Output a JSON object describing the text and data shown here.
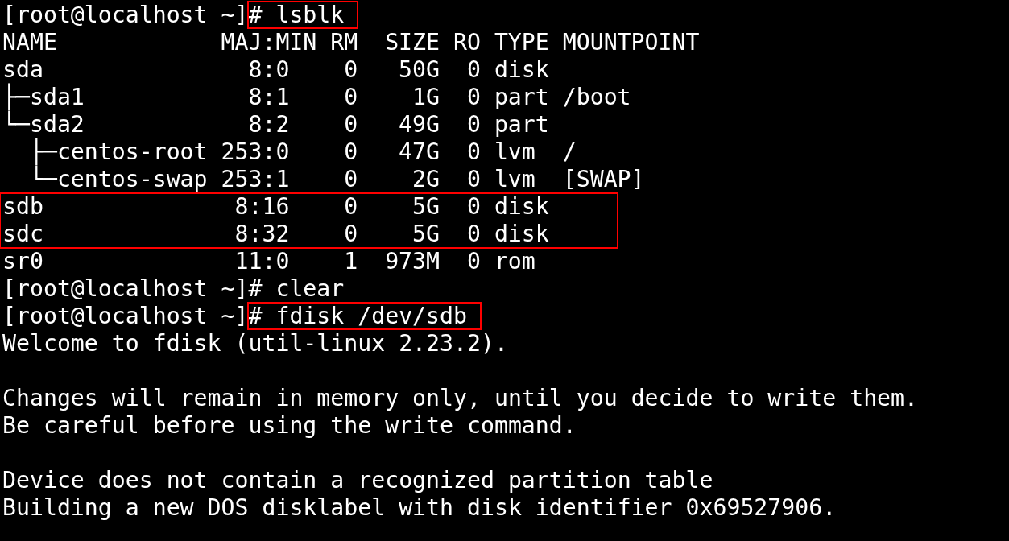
{
  "terminal": [
    {
      "kind": "prompt",
      "prompt": "[root@localhost ~]",
      "command": "# lsblk",
      "highlighted": true
    },
    {
      "kind": "table",
      "columns": [
        "NAME",
        "MAJ:MIN",
        "RM",
        "SIZE",
        "RO",
        "TYPE",
        "MOUNTPOINT"
      ],
      "rows": [
        {
          "name": "sda",
          "maj_min": "8:0",
          "rm": "0",
          "size": "50G",
          "ro": "0",
          "type": "disk",
          "highlighted": false
        },
        {
          "name": "├─sda1",
          "maj_min": "8:1",
          "rm": "0",
          "size": "1G",
          "ro": "0",
          "type": "part",
          "mountpoint": "/boot",
          "highlighted": false
        },
        {
          "name": "└─sda2",
          "maj_min": "8:2",
          "rm": "0",
          "size": "49G",
          "ro": "0",
          "type": "part",
          "highlighted": false
        },
        {
          "name": "  ├─centos-root",
          "maj_min": "253:0",
          "rm": "0",
          "size": "47G",
          "ro": "0",
          "type": "lvm",
          "mountpoint": "/",
          "highlighted": false
        },
        {
          "name": "  └─centos-swap",
          "maj_min": "253:1",
          "rm": "0",
          "size": "2G",
          "ro": "0",
          "type": "lvm",
          "mountpoint": "[SWAP]",
          "highlighted": false
        },
        {
          "name": "sdb",
          "maj_min": "8:16",
          "rm": "0",
          "size": "5G",
          "ro": "0",
          "type": "disk",
          "highlighted": true
        },
        {
          "name": "sdc",
          "maj_min": "8:32",
          "rm": "0",
          "size": "5G",
          "ro": "0",
          "type": "disk",
          "highlighted": true
        },
        {
          "name": "sr0",
          "maj_min": "11:0",
          "rm": "1",
          "size": "973M",
          "ro": "0",
          "type": "rom",
          "highlighted": false
        }
      ]
    },
    {
      "kind": "prompt",
      "prompt": "[root@localhost ~]",
      "command": "# clear",
      "highlighted": false
    },
    {
      "kind": "prompt",
      "prompt": "[root@localhost ~]",
      "command": "# fdisk /dev/sdb",
      "highlighted": true
    },
    {
      "kind": "text",
      "text": "Welcome to fdisk (util-linux 2.23.2)."
    },
    {
      "kind": "blank"
    },
    {
      "kind": "text",
      "text": "Changes will remain in memory only, until you decide to write them."
    },
    {
      "kind": "text",
      "text": "Be careful before using the write command."
    },
    {
      "kind": "blank"
    },
    {
      "kind": "text",
      "text": "Device does not contain a recognized partition table"
    },
    {
      "kind": "text",
      "text": "Building a new DOS disklabel with disk identifier 0x69527906."
    }
  ]
}
